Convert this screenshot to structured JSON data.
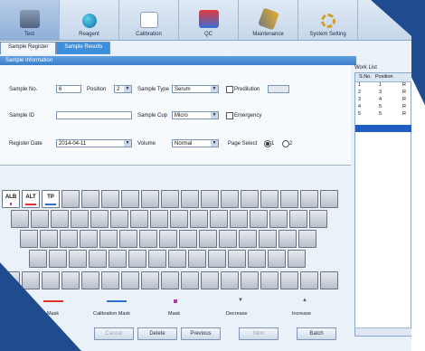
{
  "toolbar": {
    "items": [
      {
        "label": "Test",
        "icon": "test-icon"
      },
      {
        "label": "Reagent",
        "icon": "reagent-icon"
      },
      {
        "label": "Calibration",
        "icon": "calibration-icon"
      },
      {
        "label": "QC",
        "icon": "qc-icon"
      },
      {
        "label": "Maintenance",
        "icon": "maintenance-icon"
      },
      {
        "label": "System Setting",
        "icon": "system-setting-icon"
      }
    ],
    "active": "Test"
  },
  "tabs": [
    "Sample Register",
    "Sample Results"
  ],
  "sample_info": {
    "title": "Sample Information",
    "sample_no_label": "Sample No.",
    "sample_no": "6",
    "position_label": "Position",
    "position": "2",
    "sample_type_label": "Sample Type",
    "sample_type": "Serum",
    "predilution_label": "Predilution",
    "sample_id_label": "Sample ID",
    "sample_id": "",
    "sample_cup_label": "Sample Cup",
    "sample_cup": "Micro",
    "emergency_label": "Emergency",
    "register_date_label": "Register Date",
    "register_date": "2014-04-11",
    "volume_label": "Volume",
    "volume": "Normal",
    "page_select_label": "Page Select",
    "page_options": [
      "1",
      "2"
    ]
  },
  "keys": {
    "row1_labels": [
      "ALB",
      "ALT",
      "TP"
    ]
  },
  "legend": {
    "items": [
      "Mask",
      "Calibration Mask",
      "Mask",
      "Decrease",
      "Increase"
    ],
    "colors": {
      "red": "#e0302e",
      "blue": "#2f6fd0",
      "purple": "#b03ab0"
    }
  },
  "buttons": [
    "Cancel",
    "Delete",
    "Previous",
    "Next",
    "Batch"
  ],
  "worklist": {
    "title": "Work List",
    "headers": [
      "S.No.",
      "Position"
    ],
    "rows": [
      {
        "sno": "1",
        "pos": "1",
        "x": "R"
      },
      {
        "sno": "2",
        "pos": "3",
        "x": "R"
      },
      {
        "sno": "3",
        "pos": "4",
        "x": "R"
      },
      {
        "sno": "4",
        "pos": "5",
        "x": "R"
      },
      {
        "sno": "5",
        "pos": "5",
        "x": "R"
      },
      {
        "sno": "*6",
        "pos": "",
        "x": ""
      }
    ]
  }
}
